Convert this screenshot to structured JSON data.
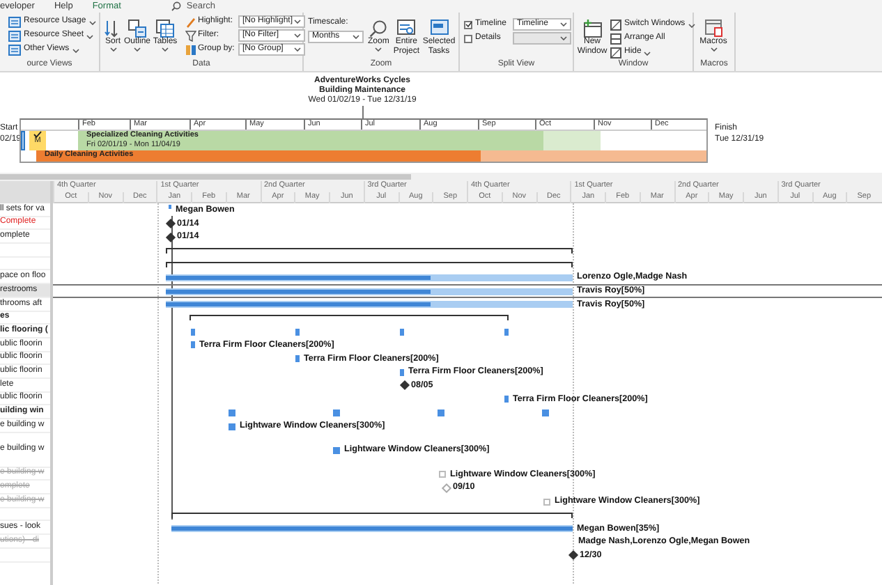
{
  "menu_tabs": [
    {
      "label": "eveloper",
      "selected": false
    },
    {
      "label": "Help",
      "selected": false
    },
    {
      "label": "Format",
      "selected": true
    }
  ],
  "search": {
    "placeholder": "Search"
  },
  "ribbon": {
    "views": {
      "label": "ource Views",
      "items": [
        "Resource Usage",
        "Resource Sheet",
        "Other Views"
      ]
    },
    "data": {
      "label": "Data",
      "buttons": [
        "Sort",
        "Outline",
        "Tables"
      ],
      "filters": [
        {
          "label": "Highlight:",
          "value": "[No Highlight]"
        },
        {
          "label": "Filter:",
          "value": "[No Filter]"
        },
        {
          "label": "Group by:",
          "value": "[No Group]"
        }
      ]
    },
    "zoom": {
      "label": "Zoom",
      "timescale_label": "Timescale:",
      "timescale_value": "Months",
      "buttons": [
        "Zoom",
        "Entire Project",
        "Selected Tasks"
      ]
    },
    "split_view": {
      "label": "Split View",
      "options": [
        {
          "label": "Timeline",
          "checked": true,
          "value": "Timeline"
        },
        {
          "label": "Details",
          "checked": false
        }
      ]
    },
    "window": {
      "label": "Window",
      "new_window": "New Window",
      "items": [
        "Switch Windows",
        "Arrange All",
        "Hide"
      ]
    },
    "macros": {
      "label": "Macros",
      "button": "Macros"
    }
  },
  "timeline": {
    "title": "AdventureWorks Cycles",
    "subtitle": "Building Maintenance",
    "dates": "Wed 01/02/19 - Tue 12/31/19",
    "start_label": "Start",
    "start_date": "02/19",
    "finish_label": "Finish",
    "finish_date": "Tue 12/31/19",
    "milestone_label": "M",
    "months": [
      "Feb",
      "Mar",
      "Apr",
      "May",
      "Jun",
      "Jul",
      "Aug",
      "Sep",
      "Oct",
      "Nov",
      "Dec"
    ],
    "bars": [
      {
        "name": "Specialized Cleaning Activities",
        "dates": "Fri 02/01/19 - Mon 11/04/19",
        "color": "#b9d9a5",
        "level": 0.89
      },
      {
        "name": "Daily Cleaning Activities",
        "color": "#ed7d31",
        "level": 0.66
      }
    ]
  },
  "gantt_header": {
    "quarters": [
      "4th Quarter",
      "1st Quarter",
      "2nd Quarter",
      "3rd Quarter",
      "4th Quarter",
      "1st Quarter",
      "2nd Quarter",
      "3rd Quarter"
    ],
    "months": [
      "Oct",
      "Nov",
      "Dec",
      "Jan",
      "Feb",
      "Mar",
      "Apr",
      "May",
      "Jun",
      "Jul",
      "Aug",
      "Sep",
      "Oct",
      "Nov",
      "Dec",
      "Jan",
      "Feb",
      "Mar",
      "Apr",
      "May",
      "Jun",
      "Jul",
      "Aug",
      "Sep"
    ]
  },
  "rows": [
    {
      "task": "ll sets for va",
      "summary": false,
      "late": false,
      "inactive": false,
      "selected": false,
      "kind": "resource",
      "label": "Megan Bowen"
    },
    {
      "task": "Complete",
      "summary": false,
      "late": true,
      "inactive": false,
      "selected": false,
      "kind": "milestone",
      "label": "01/14"
    },
    {
      "task": "omplete",
      "summary": false,
      "late": false,
      "inactive": false,
      "selected": false,
      "kind": "milestone",
      "label": "01/14"
    },
    {
      "selected": false,
      "kind": "summary"
    },
    {
      "selected": false,
      "kind": "summary"
    },
    {
      "task": "pace on floo",
      "summary": false,
      "late": false,
      "inactive": false,
      "selected": false,
      "kind": "task",
      "level": 0.65,
      "label": "Lorenzo Ogle,Madge Nash"
    },
    {
      "task": "restrooms",
      "summary": false,
      "late": false,
      "inactive": false,
      "selected": true,
      "kind": "task",
      "level": 0.65,
      "label": "Travis Roy[50%]"
    },
    {
      "task": "throoms aft",
      "summary": false,
      "late": false,
      "inactive": false,
      "selected": false,
      "kind": "task",
      "level": 0.65,
      "label": "Travis Roy[50%]"
    },
    {
      "task": "es",
      "summary": true,
      "late": false,
      "inactive": false,
      "selected": false,
      "kind": "summary"
    },
    {
      "task": "lic flooring (",
      "summary": true,
      "late": false,
      "inactive": false,
      "selected": false,
      "kind": "split"
    },
    {
      "task": "ublic floorin",
      "summary": false,
      "late": false,
      "inactive": false,
      "selected": false,
      "kind": "task",
      "label": "Terra Firm Floor Cleaners[200%]"
    },
    {
      "task": "ublic floorin",
      "summary": false,
      "late": false,
      "inactive": false,
      "selected": false,
      "kind": "task",
      "label": "Terra Firm Floor Cleaners[200%]"
    },
    {
      "task": "ublic floorin",
      "summary": false,
      "late": false,
      "inactive": false,
      "selected": false,
      "kind": "task",
      "label": "Terra Firm Floor Cleaners[200%]"
    },
    {
      "task": "lete",
      "summary": false,
      "late": false,
      "inactive": false,
      "selected": false,
      "kind": "milestone",
      "label": "08/05"
    },
    {
      "task": "ublic floorin",
      "summary": false,
      "late": false,
      "inactive": false,
      "selected": false,
      "kind": "task",
      "label": "Terra Firm Floor Cleaners[200%]"
    },
    {
      "task": "uilding win",
      "summary": true,
      "late": false,
      "inactive": false,
      "selected": false,
      "kind": "split"
    },
    {
      "task": "e building w",
      "summary": false,
      "late": false,
      "inactive": false,
      "selected": false,
      "kind": "task",
      "label": "Lightware Window Cleaners[300%]"
    },
    {
      "task": "e building w",
      "summary": false,
      "late": false,
      "inactive": false,
      "selected": false,
      "kind": "task",
      "label": "Lightware Window Cleaners[300%]"
    },
    {
      "task": "e building w",
      "summary": false,
      "late": false,
      "inactive": true,
      "selected": false,
      "kind": "empty_task",
      "label": "Lightware Window Cleaners[300%]"
    },
    {
      "task": "omplete",
      "summary": false,
      "late": false,
      "inactive": true,
      "selected": false,
      "kind": "milestone",
      "label": "09/10"
    },
    {
      "task": "e building w",
      "summary": false,
      "late": false,
      "inactive": true,
      "selected": false,
      "kind": "empty_task",
      "label": "Lightware Window Cleaners[300%]"
    },
    {
      "selected": false,
      "kind": "summary"
    },
    {
      "task": "sues - look",
      "summary": false,
      "late": false,
      "inactive": false,
      "selected": false,
      "kind": "task",
      "level": 1,
      "label": "Megan Bowen[35%]"
    },
    {
      "task": "utions) - di",
      "summary": false,
      "late": false,
      "inactive": true,
      "selected": false,
      "kind": "label",
      "label": "Madge Nash,Lorenzo Ogle,Megan Bowen"
    },
    {
      "selected": false,
      "kind": "milestone",
      "label": "12/30"
    }
  ]
}
